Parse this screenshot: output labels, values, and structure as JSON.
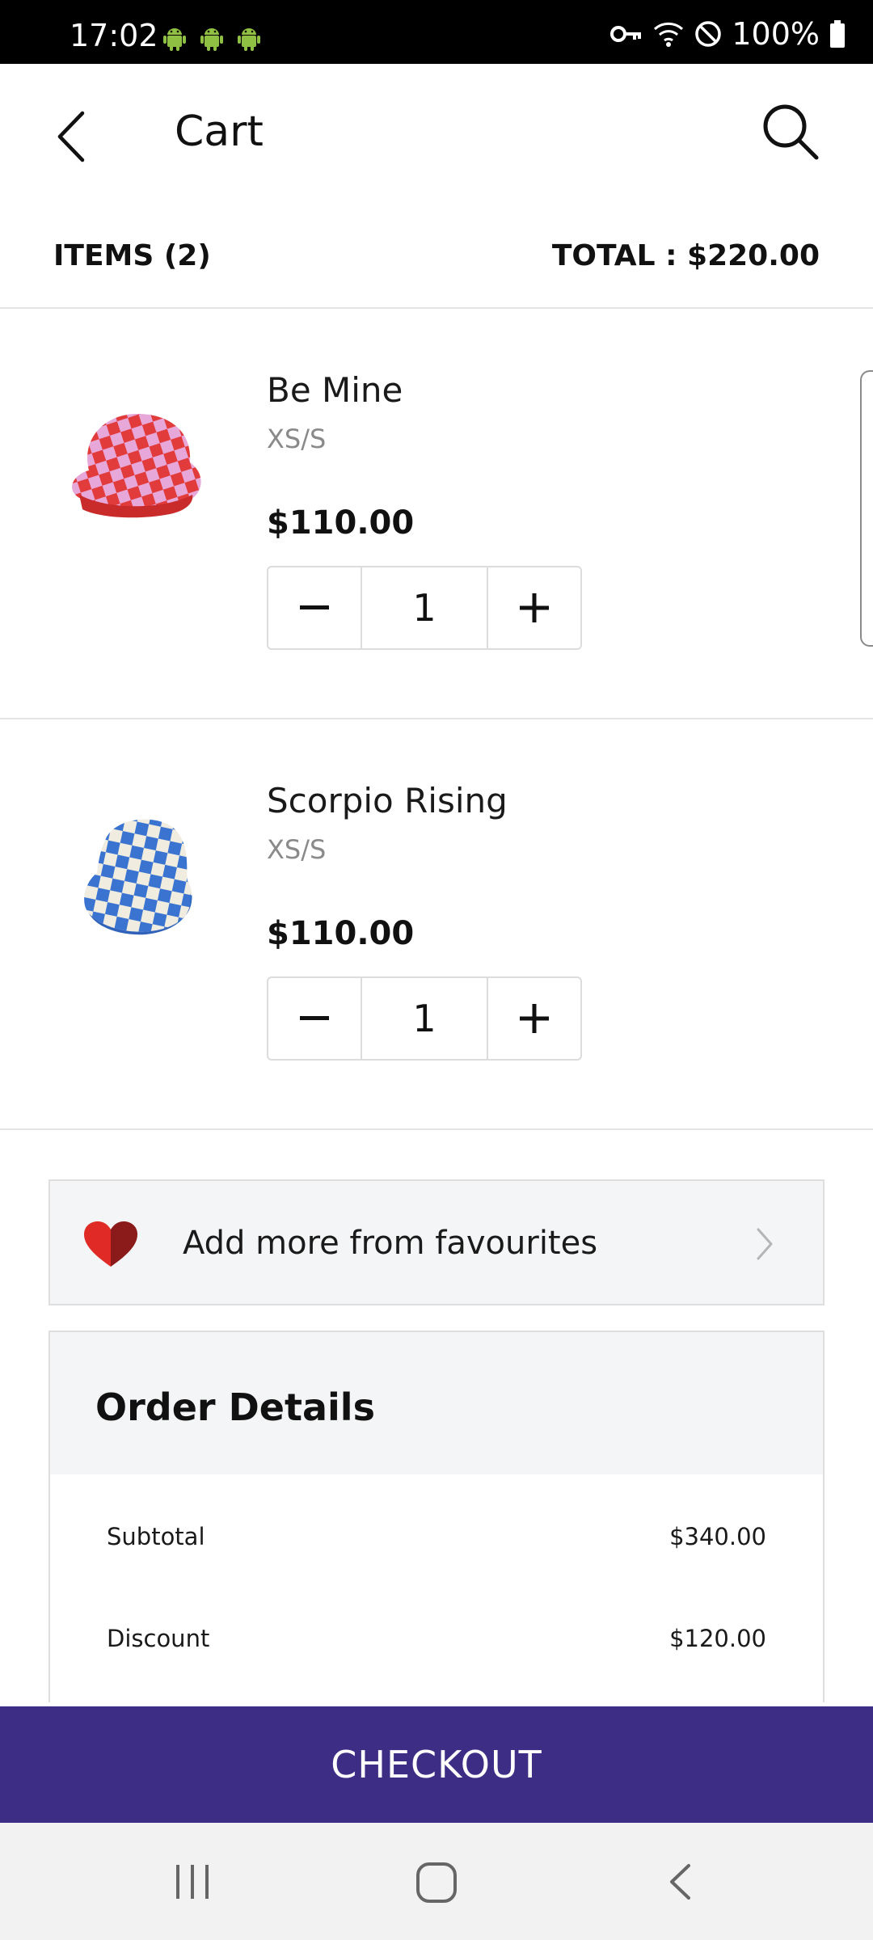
{
  "status_bar": {
    "time": "17:02",
    "battery": "100%",
    "icons": [
      "android-icon",
      "android-icon",
      "android-icon",
      "vpn-key-icon",
      "wifi-icon",
      "do-not-disturb-icon",
      "battery-icon"
    ]
  },
  "header": {
    "title": "Cart",
    "back_icon": "chevron-left-icon",
    "search_icon": "search-icon"
  },
  "summary": {
    "items": "ITEMS (2)",
    "total": "TOTAL : $220.00"
  },
  "cart_items": [
    {
      "name": "Be Mine",
      "size": "XS/S",
      "price": "$110.00",
      "quantity": "1",
      "thumb_colors": [
        "#e23b3b",
        "#e7a7d8"
      ]
    },
    {
      "name": "Scorpio Rising",
      "size": "XS/S",
      "price": "$110.00",
      "quantity": "1",
      "thumb_colors": [
        "#3a74d0",
        "#f1ece0"
      ]
    }
  ],
  "favourites": {
    "label": "Add more from favourites",
    "icon": "heart-icon",
    "chevron": "chevron-right-icon"
  },
  "order_details": {
    "title": "Order Details",
    "rows": [
      {
        "label": "Subtotal",
        "value": "$340.00"
      },
      {
        "label": "Discount",
        "value": "$120.00"
      }
    ]
  },
  "checkout": {
    "label": "CHECKOUT",
    "color": "#3d2d85"
  },
  "nav_bar": {
    "icons": [
      "recent-apps-icon",
      "home-icon",
      "back-icon"
    ]
  }
}
